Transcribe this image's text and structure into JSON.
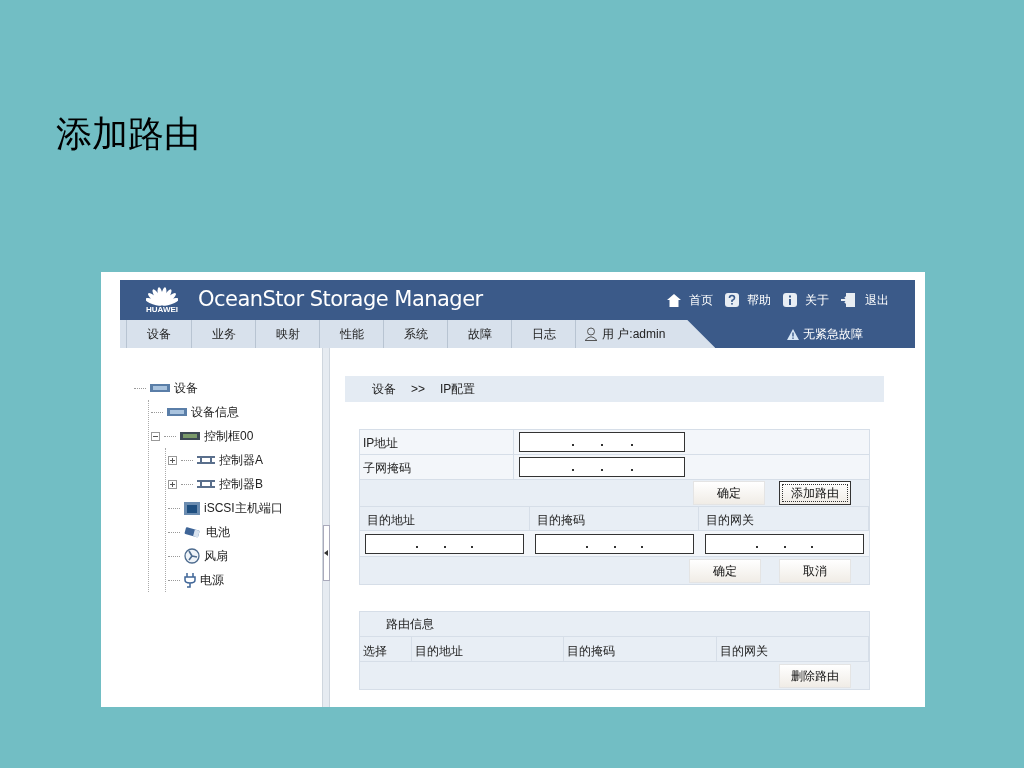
{
  "slide_title": "添加路由",
  "app": {
    "brand": "OceanStor Storage Manager",
    "logo_text": "HUAWEI",
    "top_links": [
      {
        "kind": "home",
        "label": "首页"
      },
      {
        "kind": "help",
        "label": "帮助"
      },
      {
        "kind": "info",
        "label": "关于"
      },
      {
        "kind": "exit",
        "label": "退出"
      }
    ],
    "nav_tabs": [
      "设备",
      "业务",
      "映射",
      "性能",
      "系统",
      "故障",
      "日志"
    ],
    "user": "用 户:admin",
    "alarm": "无紧急故障",
    "tree": [
      {
        "label": "设备",
        "kind": "device",
        "children": [
          {
            "label": "设备信息",
            "kind": "device"
          },
          {
            "label": "控制框00",
            "kind": "rack",
            "expanded": true,
            "children": [
              {
                "label": "控制器A",
                "kind": "controller",
                "expanded": false
              },
              {
                "label": "控制器B",
                "kind": "controller",
                "expanded": false
              },
              {
                "label": "iSCSI主机端口",
                "kind": "port"
              },
              {
                "label": "电池",
                "kind": "battery"
              },
              {
                "label": "风扇",
                "kind": "fan"
              },
              {
                "label": "电源",
                "kind": "power"
              }
            ]
          }
        ]
      }
    ],
    "breadcrumb": [
      "设备",
      ">>",
      "IP配置"
    ],
    "ip_form": {
      "rows": [
        "IP地址",
        "子网掩码"
      ],
      "buttons": [
        "确定",
        "添加路由"
      ]
    },
    "route_form": {
      "columns": [
        "目的地址",
        "目的掩码",
        "目的网关"
      ],
      "buttons": [
        "确定",
        "取消"
      ]
    },
    "route_info": {
      "title": "路由信息",
      "columns": [
        "选择",
        "目的地址",
        "目的掩码",
        "目的网关"
      ],
      "buttons": [
        "删除路由"
      ]
    }
  }
}
